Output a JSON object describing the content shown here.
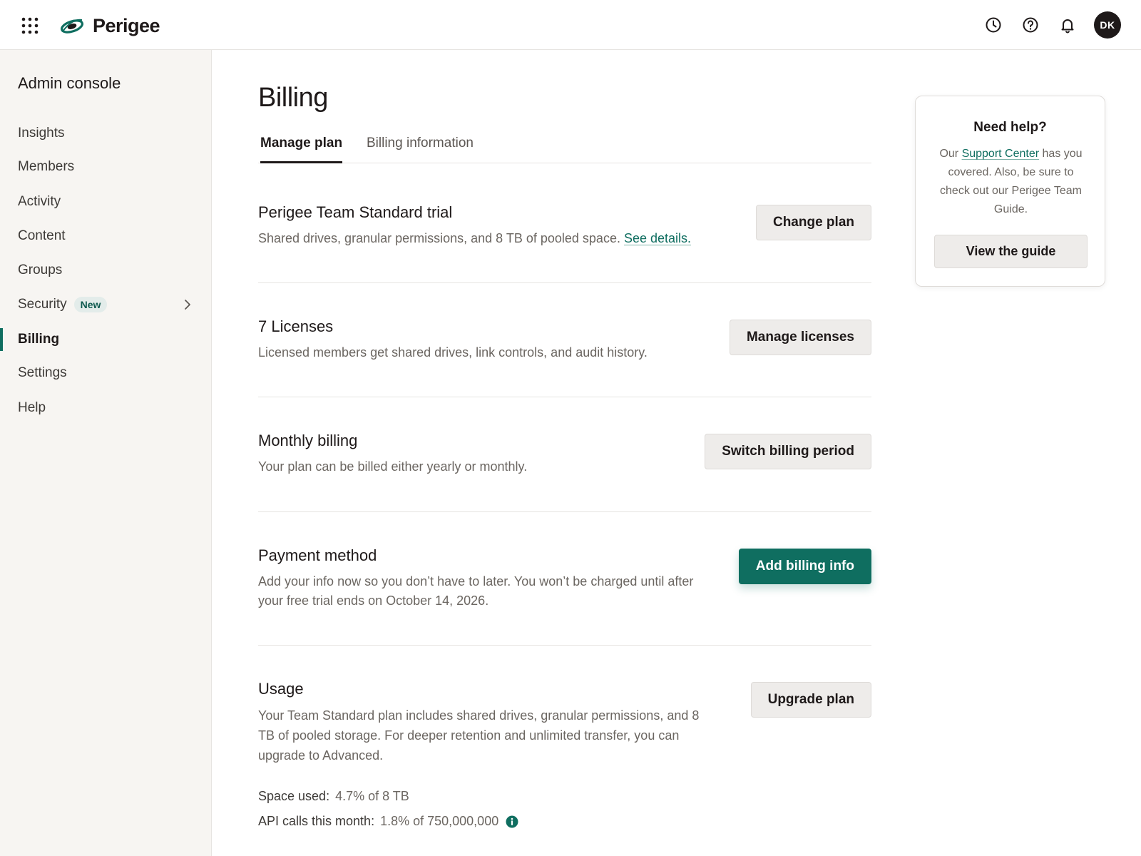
{
  "header": {
    "app_name": "Perigee",
    "avatar_initials": "DK",
    "icons": [
      "apps-grid-icon",
      "history-icon",
      "help-icon",
      "bell-icon"
    ]
  },
  "sidebar": {
    "title": "Admin console",
    "items": [
      {
        "label": "Insights"
      },
      {
        "label": "Members"
      },
      {
        "label": "Activity"
      },
      {
        "label": "Content"
      },
      {
        "label": "Groups"
      },
      {
        "label": "Security",
        "badge": "New"
      },
      {
        "label": "Billing",
        "active": true
      },
      {
        "label": "Settings"
      },
      {
        "label": "Help"
      }
    ]
  },
  "main": {
    "title": "Billing",
    "tabs": [
      {
        "label": "Manage plan",
        "active": true
      },
      {
        "label": "Billing information"
      }
    ],
    "sections": [
      {
        "title": "Perigee Team Standard trial",
        "desc": "Shared drives, granular permissions, and 8 TB of pooled space.",
        "link": "See details.",
        "button": "Change plan"
      },
      {
        "title": "7 Licenses",
        "desc": "Licensed members get shared drives, link controls, and audit history.",
        "button": "Manage licenses"
      },
      {
        "title": "Monthly billing",
        "desc": "Your plan can be billed either yearly or monthly.",
        "button": "Switch billing period"
      },
      {
        "title": "Payment method",
        "desc": "Add your info now so you don’t have to later. You won’t be charged until after your free trial ends on October 14, 2026.",
        "button": "Add billing info"
      },
      {
        "title": "Usage",
        "desc": "Your Team Standard plan includes shared drives, granular permissions, and 8 TB of pooled storage. For deeper retention and unlimited transfer, you can upgrade to Advanced.",
        "button": "Upgrade plan",
        "space_label": "Space used:",
        "space_value": "4.7% of 8 TB",
        "api_label": "API calls this month:",
        "api_value": "1.8% of 750,000,000"
      }
    ]
  },
  "help_card": {
    "title": "Need help?",
    "text_before": "Our ",
    "link": "Support Center",
    "text_after": " has you covered. Also, be sure to check out our Perigee Team Guide.",
    "button": "View the guide"
  },
  "colors": {
    "accent": "#0f6e60",
    "text": "#1e1919",
    "muted": "#6b6661",
    "sidebar_bg": "#f7f5f2"
  }
}
